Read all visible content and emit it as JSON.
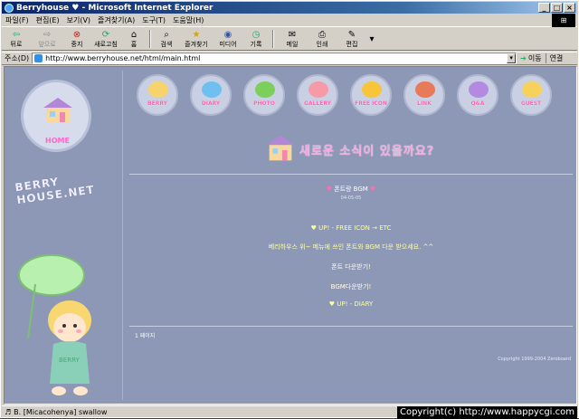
{
  "window": {
    "title": "Berryhouse ♥ - Microsoft Internet Explorer",
    "min": "_",
    "max": "□",
    "close": "×"
  },
  "menu": [
    "파일(F)",
    "편집(E)",
    "보기(V)",
    "즐겨찾기(A)",
    "도구(T)",
    "도움말(H)"
  ],
  "toolbar": {
    "back": "뒤로",
    "forward": "앞으로",
    "stop": "중지",
    "refresh": "새로고침",
    "home": "홈",
    "search": "검색",
    "favorites": "즐겨찾기",
    "media": "미디어",
    "history": "기록",
    "mail": "메일",
    "print": "인쇄",
    "edit": "편집"
  },
  "address": {
    "label": "주소(D)",
    "url": "http://www.berryhouse.net/html/main.html",
    "go": "이동",
    "links": "연결"
  },
  "site": {
    "home_label": "HOME",
    "brand": "BERRY HOUSE.NET",
    "nav": [
      {
        "label": "BERRY",
        "color": "#f7d36b"
      },
      {
        "label": "DIARY",
        "color": "#6fc0f0"
      },
      {
        "label": "PHOTO",
        "color": "#7ccf5a"
      },
      {
        "label": "GALLERY",
        "color": "#f79aa8"
      },
      {
        "label": "FREE ICON",
        "color": "#f8c53a"
      },
      {
        "label": "LINK",
        "color": "#e87a5a"
      },
      {
        "label": "Q&A",
        "color": "#b48ae0"
      },
      {
        "label": "GUEST",
        "color": "#f6d25c"
      }
    ],
    "headline": "새로운 소식이 있을까요?",
    "post_title": "폰트랑 BGM",
    "post_date": "04-05-05",
    "line1": "♥ UP! - FREE ICON → ETC",
    "line2": "베리하우스 위~ 메뉴에 쓰인 폰트와 BGM 다운 받으세요. ^^",
    "line3": "폰트 다운받기!",
    "line4": "BGM다운받기!",
    "line5": "♥ UP! - DIARY",
    "pager": "1 페이지",
    "copyright": "Copyright 1999-2004 Zeroboard"
  },
  "status": {
    "text": "B. [Micacohenya] swallow",
    "watermark": "Copyright(c) http://www.happycgi.com"
  }
}
